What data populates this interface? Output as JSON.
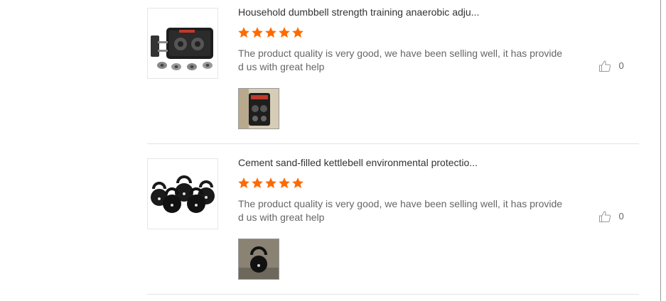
{
  "colors": {
    "star": "#ff6a00",
    "title_text": "#333333",
    "comment_text": "#666666",
    "divider": "#e3e3e3"
  },
  "icons": {
    "rating": "star-icon",
    "like": "thumbs-up-icon"
  },
  "reviews": [
    {
      "product_title": "Household dumbbell strength training anaerobic adju...",
      "rating": 5,
      "rating_max": 5,
      "comment_line1": "The product quality is very good, we have been selling well, it has provide",
      "comment_line2": "d us with great help",
      "likes": "0"
    },
    {
      "product_title": "Cement sand-filled kettlebell environmental protectio...",
      "rating": 5,
      "rating_max": 5,
      "comment_line1": "The product quality is very good, we have been selling well, it has provide",
      "comment_line2": "d us with great help",
      "likes": "0"
    }
  ]
}
